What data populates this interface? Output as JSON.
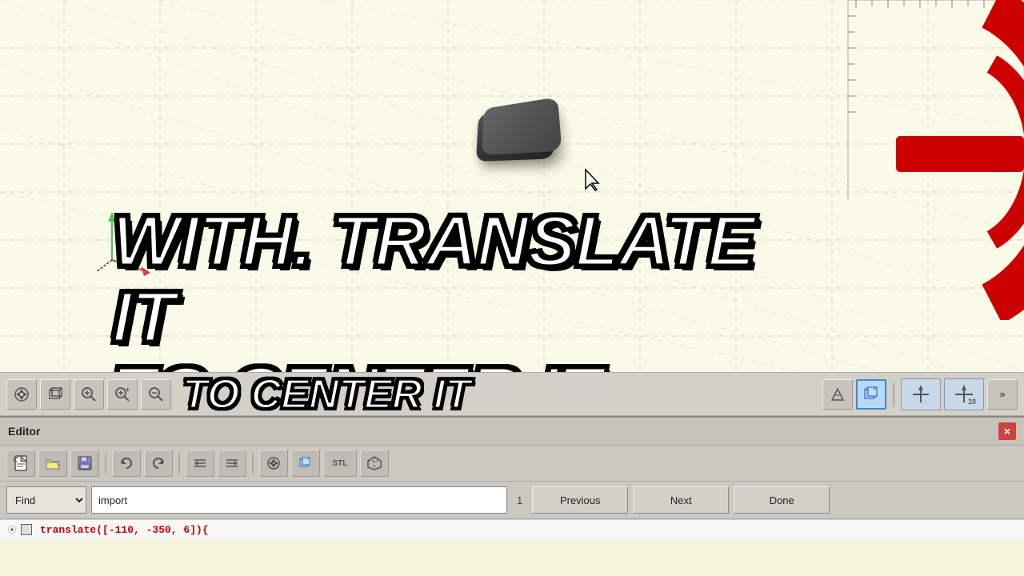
{
  "viewport": {
    "background_color": "#fafae8"
  },
  "overlay_text": {
    "line1": "WITH. TRANSLATE IT",
    "line2": "TO CENTER IT"
  },
  "toolbar": {
    "buttons": [
      {
        "id": "view-all",
        "icon": "⬡",
        "label": "View All"
      },
      {
        "id": "view-3d",
        "icon": "◻",
        "label": "3D View"
      },
      {
        "id": "zoom-search",
        "icon": "⊕",
        "label": "Zoom Search"
      },
      {
        "id": "zoom-in",
        "icon": "+",
        "label": "Zoom In"
      },
      {
        "id": "zoom-out",
        "icon": "−",
        "label": "Zoom Out"
      }
    ],
    "right_buttons": [
      {
        "id": "view-angle",
        "icon": "◺",
        "label": "View Angle"
      },
      {
        "id": "view-cube",
        "icon": "⬛",
        "label": "View Cube"
      },
      {
        "id": "axis-left",
        "icon": "⊣",
        "label": "Axis Left"
      },
      {
        "id": "axis-num",
        "icon": "10",
        "label": "Axis Num"
      },
      {
        "id": "more",
        "icon": "»",
        "label": "More"
      }
    ]
  },
  "editor": {
    "title": "Editor",
    "close_label": "×",
    "toolbar_buttons": [
      {
        "id": "new-file",
        "icon": "📄",
        "label": "New File"
      },
      {
        "id": "open-file",
        "icon": "📂",
        "label": "Open File"
      },
      {
        "id": "save-file",
        "icon": "💾",
        "label": "Save File"
      },
      {
        "id": "undo",
        "icon": "↩",
        "label": "Undo"
      },
      {
        "id": "redo",
        "icon": "↪",
        "label": "Redo"
      },
      {
        "id": "indent-less",
        "icon": "◁",
        "label": "Indent Less"
      },
      {
        "id": "indent-more",
        "icon": "▷",
        "label": "Indent More"
      },
      {
        "id": "preview",
        "icon": "⬡",
        "label": "Preview"
      },
      {
        "id": "render",
        "icon": "◻",
        "label": "Render"
      },
      {
        "id": "export-stl",
        "icon": "STL",
        "label": "Export STL"
      },
      {
        "id": "export-3d",
        "icon": "⬦",
        "label": "Export 3D"
      }
    ],
    "find_bar": {
      "find_label": "Find",
      "find_value": "import",
      "find_count": "1",
      "previous_label": "Previous",
      "next_label": "Next",
      "done_label": "Done"
    },
    "code_line": "translate([-110, -350, 6]){"
  }
}
